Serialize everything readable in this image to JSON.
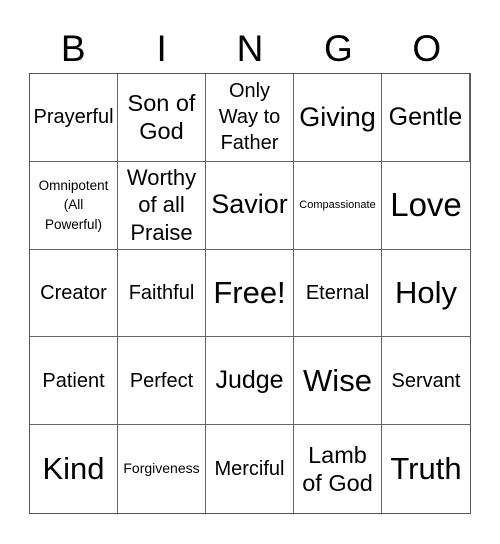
{
  "header": {
    "letters": [
      "B",
      "I",
      "N",
      "G",
      "O"
    ]
  },
  "grid": {
    "rows": [
      [
        "Prayerful",
        "Son of\nGod",
        "Only\nWay to\nFather",
        "Giving",
        "Gentle"
      ],
      [
        "Omnipotent\n(All\nPowerful)",
        "Worthy\nof all\nPraise",
        "Savior",
        "Compassionate",
        "Love"
      ],
      [
        "Creator",
        "Faithful",
        "Free!",
        "Eternal",
        "Holy"
      ],
      [
        "Patient",
        "Perfect",
        "Judge",
        "Wise",
        "Servant"
      ],
      [
        "Kind",
        "Forgiveness",
        "Merciful",
        "Lamb\nof God",
        "Truth"
      ]
    ]
  }
}
